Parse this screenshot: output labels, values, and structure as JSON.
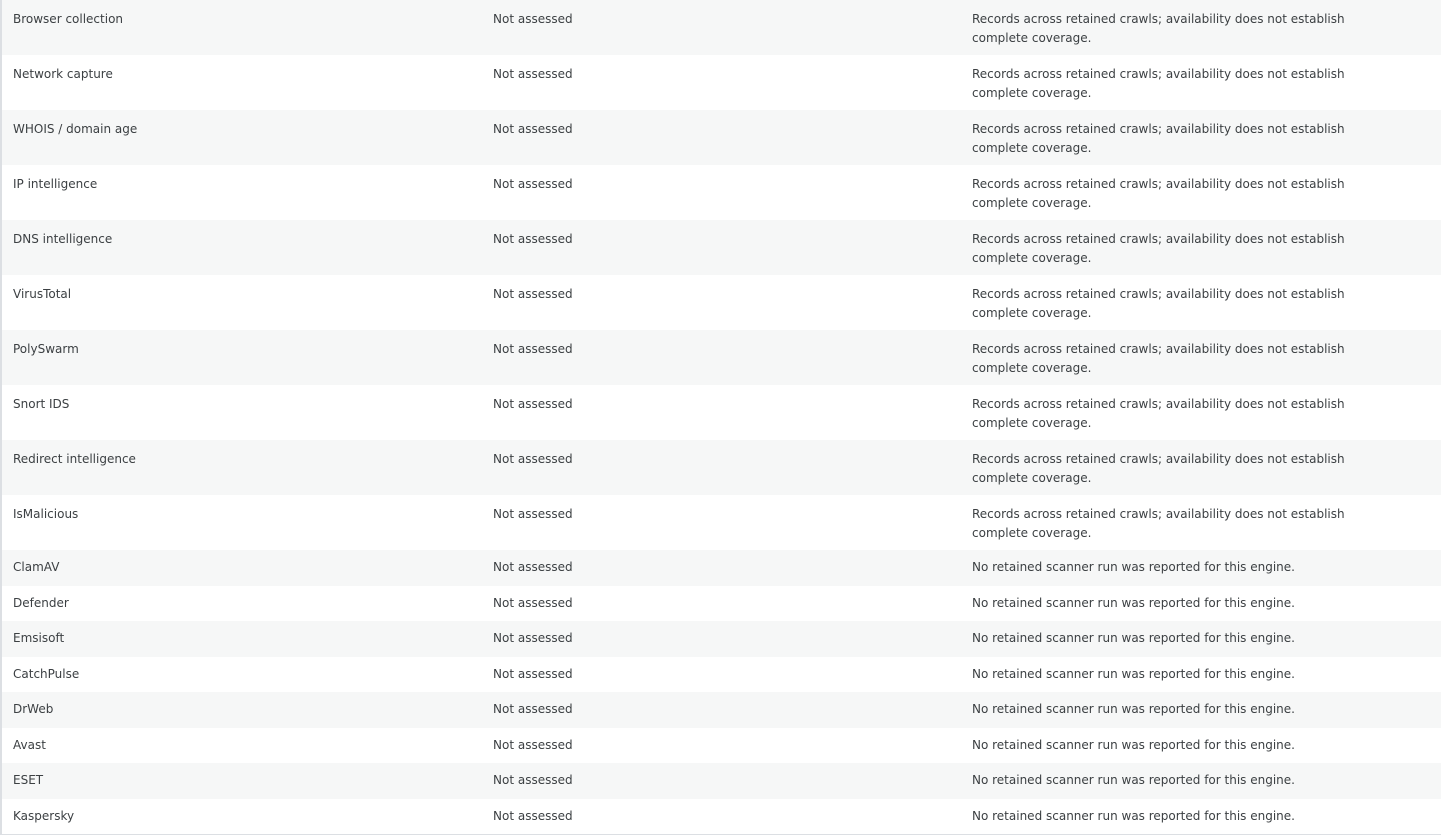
{
  "rows": [
    {
      "name": "Browser collection",
      "status": "Not assessed",
      "note": "Records across retained crawls; availability does not establish complete coverage."
    },
    {
      "name": "Network capture",
      "status": "Not assessed",
      "note": "Records across retained crawls; availability does not establish complete coverage."
    },
    {
      "name": "WHOIS / domain age",
      "status": "Not assessed",
      "note": "Records across retained crawls; availability does not establish complete coverage."
    },
    {
      "name": "IP intelligence",
      "status": "Not assessed",
      "note": "Records across retained crawls; availability does not establish complete coverage."
    },
    {
      "name": "DNS intelligence",
      "status": "Not assessed",
      "note": "Records across retained crawls; availability does not establish complete coverage."
    },
    {
      "name": "VirusTotal",
      "status": "Not assessed",
      "note": "Records across retained crawls; availability does not establish complete coverage."
    },
    {
      "name": "PolySwarm",
      "status": "Not assessed",
      "note": "Records across retained crawls; availability does not establish complete coverage."
    },
    {
      "name": "Snort IDS",
      "status": "Not assessed",
      "note": "Records across retained crawls; availability does not establish complete coverage."
    },
    {
      "name": "Redirect intelligence",
      "status": "Not assessed",
      "note": "Records across retained crawls; availability does not establish complete coverage."
    },
    {
      "name": "IsMalicious",
      "status": "Not assessed",
      "note": "Records across retained crawls; availability does not establish complete coverage."
    },
    {
      "name": "ClamAV",
      "status": "Not assessed",
      "note": "No retained scanner run was reported for this engine."
    },
    {
      "name": "Defender",
      "status": "Not assessed",
      "note": "No retained scanner run was reported for this engine."
    },
    {
      "name": "Emsisoft",
      "status": "Not assessed",
      "note": "No retained scanner run was reported for this engine."
    },
    {
      "name": "CatchPulse",
      "status": "Not assessed",
      "note": "No retained scanner run was reported for this engine."
    },
    {
      "name": "DrWeb",
      "status": "Not assessed",
      "note": "No retained scanner run was reported for this engine."
    },
    {
      "name": "Avast",
      "status": "Not assessed",
      "note": "No retained scanner run was reported for this engine."
    },
    {
      "name": "ESET",
      "status": "Not assessed",
      "note": "No retained scanner run was reported for this engine."
    },
    {
      "name": "Kaspersky",
      "status": "Not assessed",
      "note": "No retained scanner run was reported for this engine."
    }
  ]
}
